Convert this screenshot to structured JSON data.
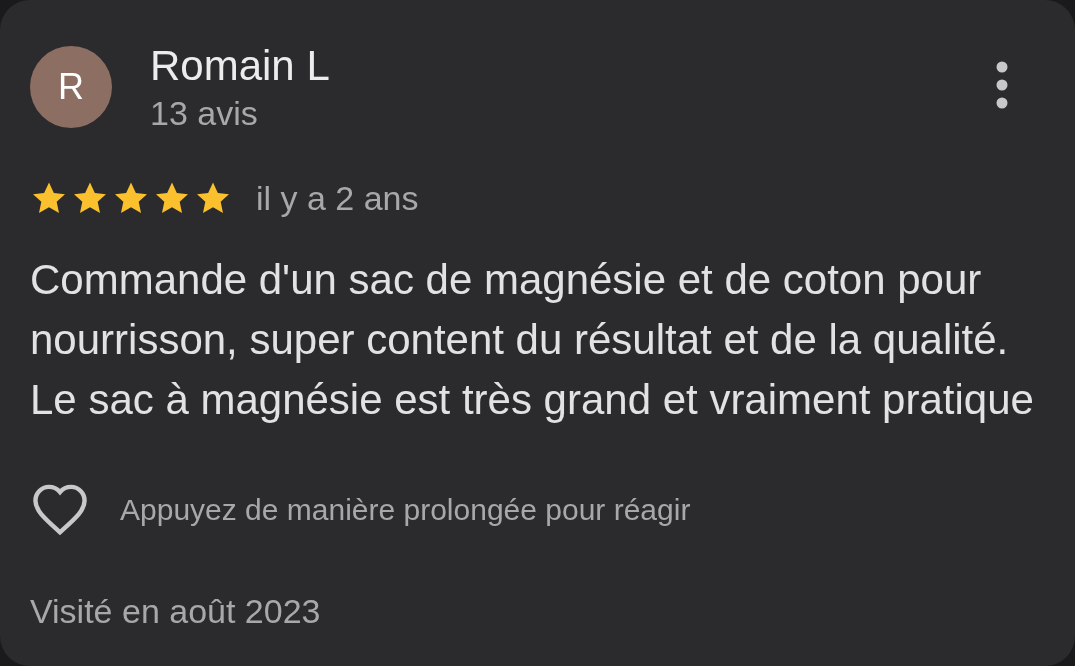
{
  "review": {
    "avatar_letter": "R",
    "author": "Romain L",
    "review_count": "13 avis",
    "stars": 5,
    "time": "il y a 2 ans",
    "text": "Commande d'un sac de magnésie et de coton pour nourrisson, super content du résultat et de la qualité. Le sac à magnésie est très grand et vraiment pratique",
    "react_hint": "Appuyez de manière prolongée pour réagir",
    "visited": "Visité en août 2023"
  }
}
